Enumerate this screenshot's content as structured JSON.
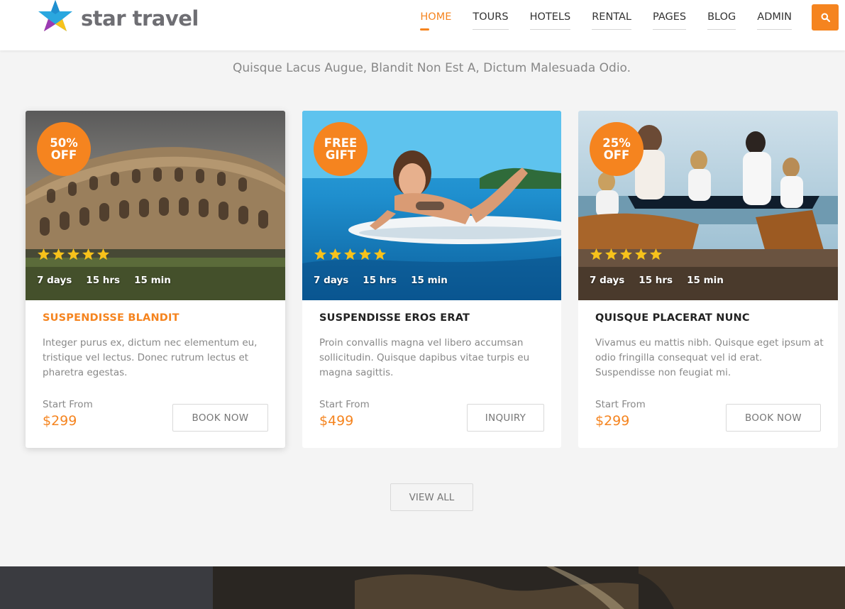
{
  "brand": {
    "name": "star travel"
  },
  "nav": {
    "items": [
      {
        "label": "HOME",
        "active": true
      },
      {
        "label": "TOURS",
        "active": false
      },
      {
        "label": "HOTELS",
        "active": false
      },
      {
        "label": "RENTAL",
        "active": false
      },
      {
        "label": "PAGES",
        "active": false
      },
      {
        "label": "BLOG",
        "active": false
      },
      {
        "label": "ADMIN",
        "active": false
      }
    ],
    "search_icon": "search-icon"
  },
  "section": {
    "subtitle": "Quisque Lacus Augue, Blandit Non Est A, Dictum Malesuada Odio."
  },
  "cards": [
    {
      "badge": "50%\nOFF",
      "rating": 5,
      "days": "7 days",
      "hours": "15 hrs",
      "minutes": "15 min",
      "title": "SUSPENDISSE BLANDIT",
      "description": "Integer purus ex, dictum nec elementum eu, tristique vel lectus. Donec rutrum lectus et pharetra egestas.",
      "start_label": "Start From",
      "price": "$299",
      "button": "BOOK NOW"
    },
    {
      "badge": "FREE\nGIFT",
      "rating": 5,
      "days": "7 days",
      "hours": "15 hrs",
      "minutes": "15 min",
      "title": "SUSPENDISSE EROS ERAT",
      "description": "Proin convallis magna vel libero accumsan sollicitudin. Quisque dapibus vitae turpis eu magna sagittis.",
      "start_label": "Start From",
      "price": "$499",
      "button": "INQUIRY"
    },
    {
      "badge": "25%\nOFF",
      "rating": 5,
      "days": "7 days",
      "hours": "15 hrs",
      "minutes": "15 min",
      "title": "QUISQUE PLACERAT NUNC",
      "description": "Vivamus eu mattis nibh. Quisque eget ipsum at odio fringilla consequat vel id erat. Suspendisse non feugiat mi.",
      "start_label": "Start From",
      "price": "$299",
      "button": "BOOK NOW"
    }
  ],
  "view_all": "VIEW ALL",
  "colors": {
    "accent": "#f5841f",
    "star": "#f7c21b",
    "text": "#222222",
    "muted": "#888888"
  }
}
